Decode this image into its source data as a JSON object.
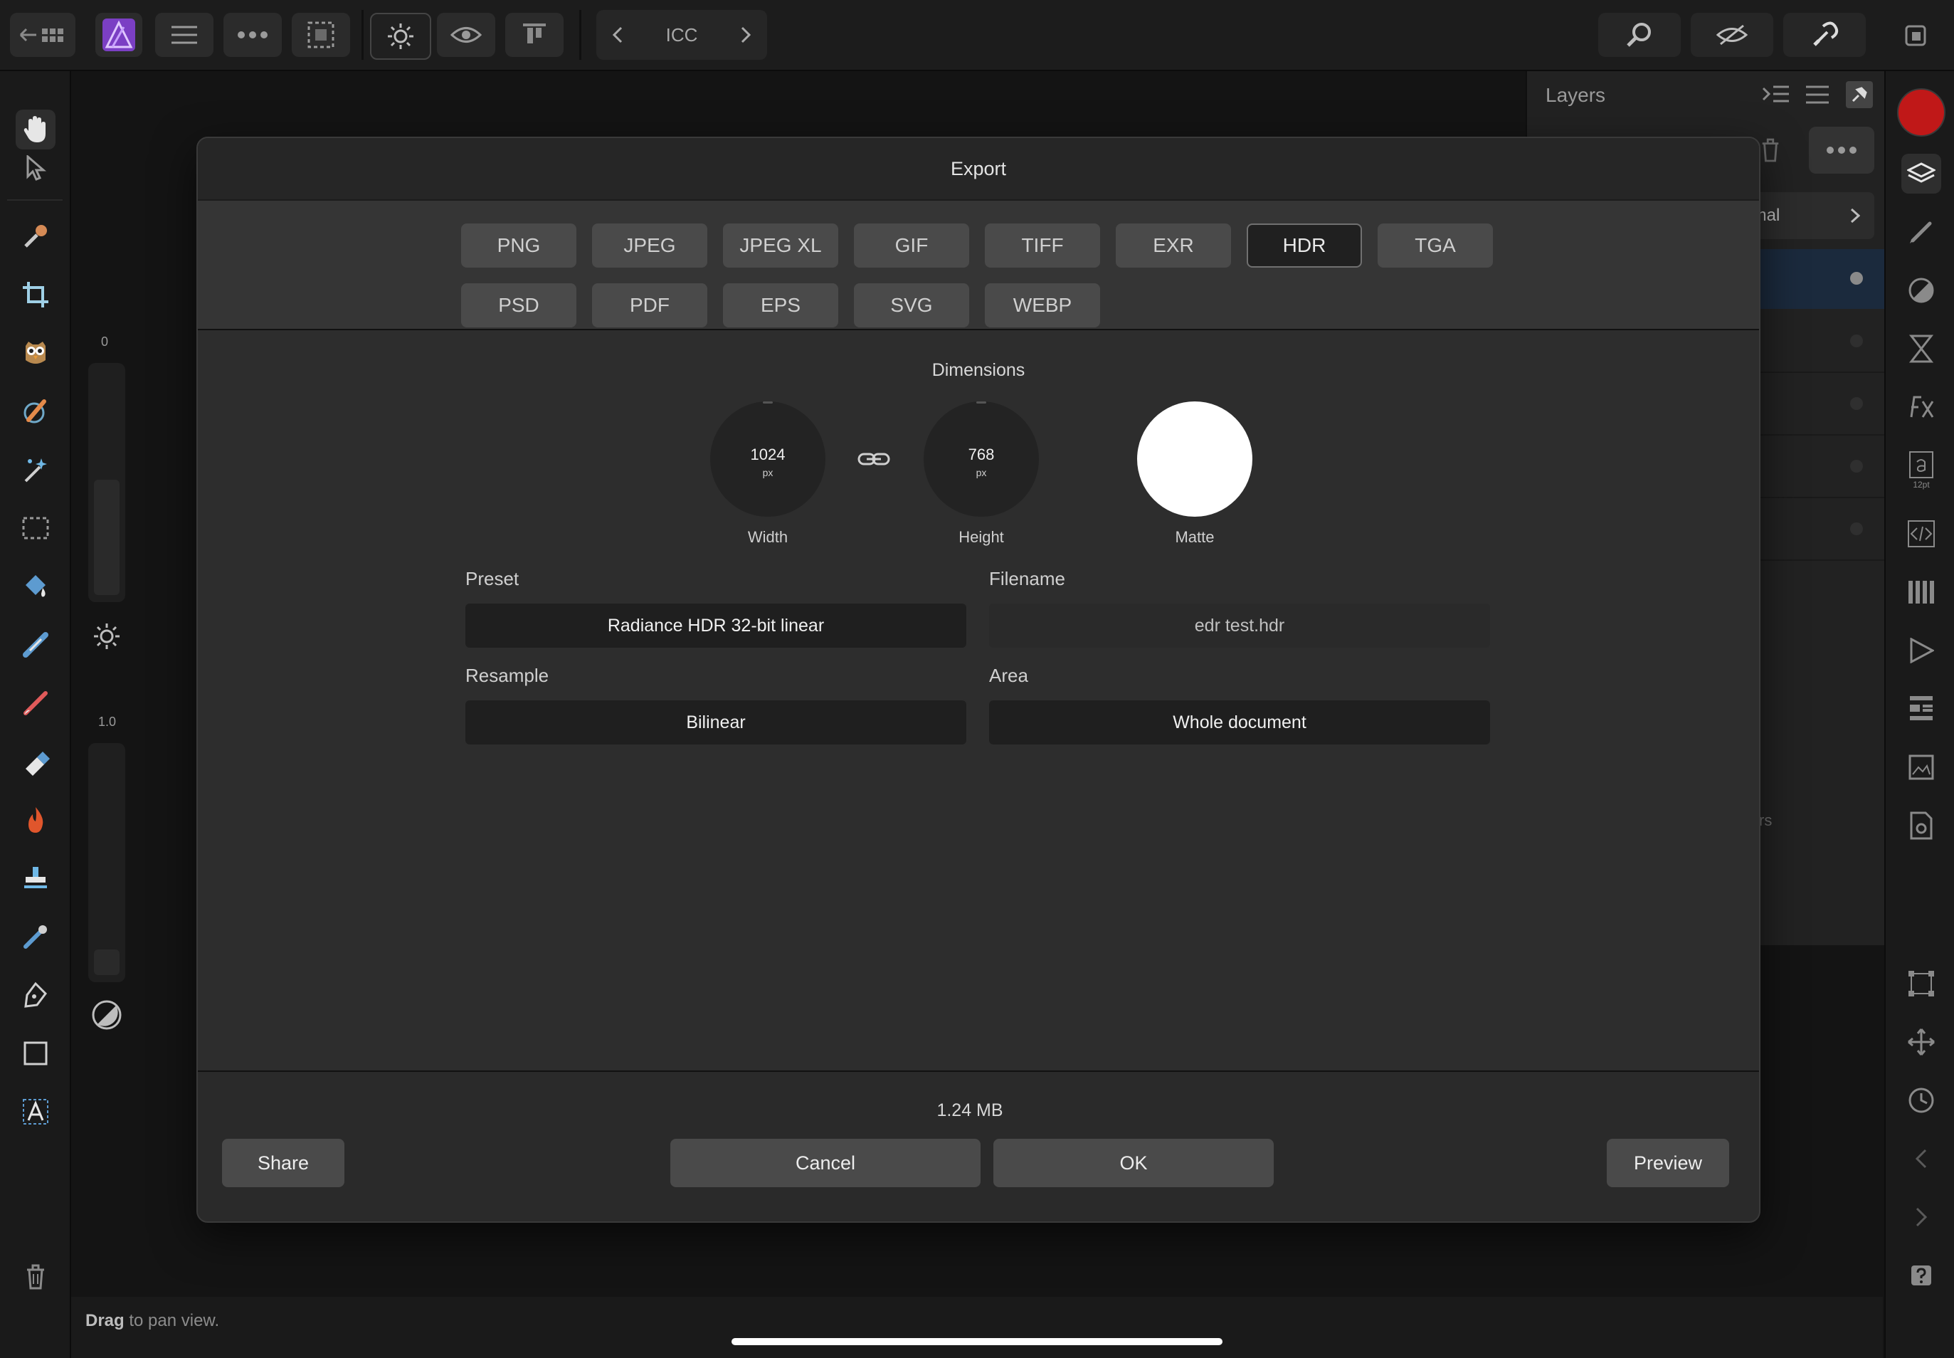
{
  "toolbar": {
    "icc_label": "ICC"
  },
  "left_sliders": {
    "top_label": "0",
    "bottom_label": "1.0"
  },
  "layers_panel": {
    "title": "Layers",
    "blend_mode_partial": "lormal",
    "partial_text": "rs"
  },
  "dialog": {
    "title": "Export",
    "formats_row1": [
      "PNG",
      "JPEG",
      "JPEG XL",
      "GIF",
      "TIFF",
      "EXR",
      "HDR",
      "TGA"
    ],
    "formats_row2": [
      "PSD",
      "PDF",
      "EPS",
      "SVG",
      "WEBP"
    ],
    "selected_format": "HDR",
    "dimensions": {
      "title": "Dimensions",
      "width_value": "1024",
      "width_unit": "px",
      "width_label": "Width",
      "height_value": "768",
      "height_unit": "px",
      "height_label": "Height",
      "matte_label": "Matte",
      "matte_color": "#ffffff"
    },
    "preset": {
      "label": "Preset",
      "value": "Radiance HDR 32-bit linear"
    },
    "filename": {
      "label": "Filename",
      "value": "edr test.hdr"
    },
    "resample": {
      "label": "Resample",
      "value": "Bilinear"
    },
    "area": {
      "label": "Area",
      "value": "Whole document"
    },
    "file_size": "1.24 MB",
    "buttons": {
      "share": "Share",
      "cancel": "Cancel",
      "ok": "OK",
      "preview": "Preview"
    }
  },
  "status": {
    "bold": "Drag",
    "rest": " to pan view."
  },
  "colors": {
    "accent_purple": "#7b3fc4",
    "record_red": "#c01818",
    "layer_selected": "#1b2a3d"
  }
}
